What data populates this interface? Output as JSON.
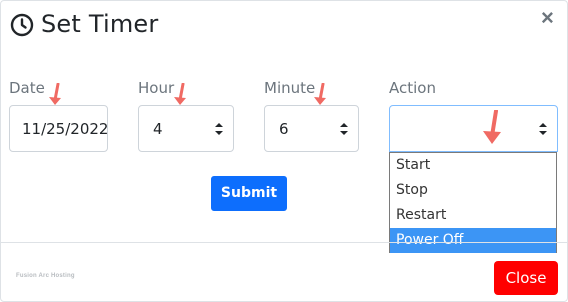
{
  "header": {
    "title": "Set Timer",
    "close_symbol": "×",
    "icon": "clock-icon"
  },
  "fields": {
    "date": {
      "label": "Date",
      "value": "11/25/2022"
    },
    "hour": {
      "label": "Hour",
      "value": "4"
    },
    "minute": {
      "label": "Minute",
      "value": "6"
    },
    "action": {
      "label": "Action",
      "value": ""
    }
  },
  "action_dropdown": {
    "options": [
      "Start",
      "Stop",
      "Restart",
      "Power Off"
    ],
    "highlighted": "Power Off"
  },
  "buttons": {
    "submit": "Submit",
    "close": "Close"
  },
  "footer": {
    "brand": "Fusion Arc Hosting"
  },
  "colors": {
    "primary": "#0d6efd",
    "danger": "#ff0000",
    "highlight": "#3c95f5",
    "annotation_arrow": "#f06a63"
  }
}
